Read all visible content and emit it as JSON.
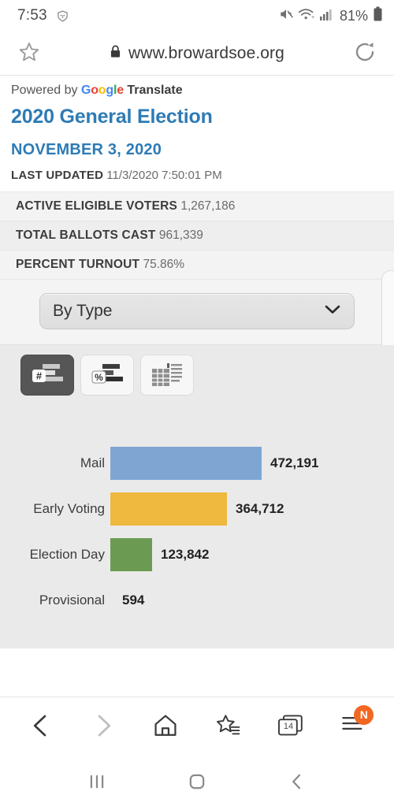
{
  "status_bar": {
    "time": "7:53",
    "battery_percent": "81%",
    "icons": [
      "vpn-shield-icon",
      "mute-icon",
      "wifi-icon",
      "signal-icon",
      "battery-icon"
    ]
  },
  "url_bar": {
    "url": "www.browardsoe.org",
    "lock_icon": "lock-icon",
    "bookmark_icon": "star-icon",
    "reload_icon": "reload-icon"
  },
  "page": {
    "translate": {
      "prefix": "Powered by",
      "brand": "Google",
      "suffix": "Translate"
    },
    "title": "2020 General Election",
    "subtitle": "NOVEMBER 3, 2020",
    "last_updated_label": "LAST UPDATED",
    "last_updated_value": "11/3/2020 7:50:01 PM",
    "stats": [
      {
        "label": "ACTIVE ELIGIBLE VOTERS",
        "value": "1,267,186"
      },
      {
        "label": "TOTAL BALLOTS CAST",
        "value": "961,339"
      },
      {
        "label": "PERCENT TURNOUT",
        "value": "75.86%"
      }
    ],
    "dropdown": {
      "selected": "By Type",
      "chevron_icon": "chevron-down-icon"
    },
    "view_buttons": [
      {
        "name": "number-chart-view",
        "icon": "bar-chart-number-icon",
        "label": "#",
        "active": true
      },
      {
        "name": "percent-chart-view",
        "icon": "bar-chart-percent-icon",
        "label": "%",
        "active": false
      },
      {
        "name": "table-view",
        "icon": "table-grid-icon",
        "label": "",
        "active": false
      }
    ]
  },
  "chart_data": {
    "type": "bar",
    "orientation": "horizontal",
    "title": "",
    "xlabel": "",
    "ylabel": "",
    "categories": [
      "Mail",
      "Early Voting",
      "Election Day",
      "Provisional"
    ],
    "values": [
      472191,
      364712,
      123842,
      594
    ],
    "value_labels": [
      "472,191",
      "364,712",
      "123,842",
      "594"
    ],
    "colors": [
      "#7FA6D3",
      "#EFB93F",
      "#6B9B52",
      "#7FA6D3"
    ],
    "xlim": [
      0,
      472191
    ],
    "grid": false,
    "legend": false,
    "background": "#eaeaea"
  },
  "browser_nav": [
    {
      "name": "back-button",
      "icon": "chevron-left-icon",
      "enabled": true
    },
    {
      "name": "forward-button",
      "icon": "chevron-right-icon",
      "enabled": false
    },
    {
      "name": "home-button",
      "icon": "home-icon",
      "enabled": true
    },
    {
      "name": "bookmarks-button",
      "icon": "star-list-icon",
      "enabled": true
    },
    {
      "name": "tabs-button",
      "icon": "tabs-icon",
      "count": "14"
    },
    {
      "name": "menu-button",
      "icon": "hamburger-menu-icon",
      "badge": "N"
    }
  ],
  "system_nav": [
    {
      "name": "recents-button",
      "icon": "recents-icon"
    },
    {
      "name": "home-button",
      "icon": "home-square-icon"
    },
    {
      "name": "back-button",
      "icon": "back-chevron-icon"
    }
  ],
  "colors": {
    "accent_blue": "#2E7BB5",
    "badge_orange": "#F26722",
    "bar_blue": "#7FA6D3",
    "bar_amber": "#EFB93F",
    "bar_green": "#6B9B52"
  }
}
